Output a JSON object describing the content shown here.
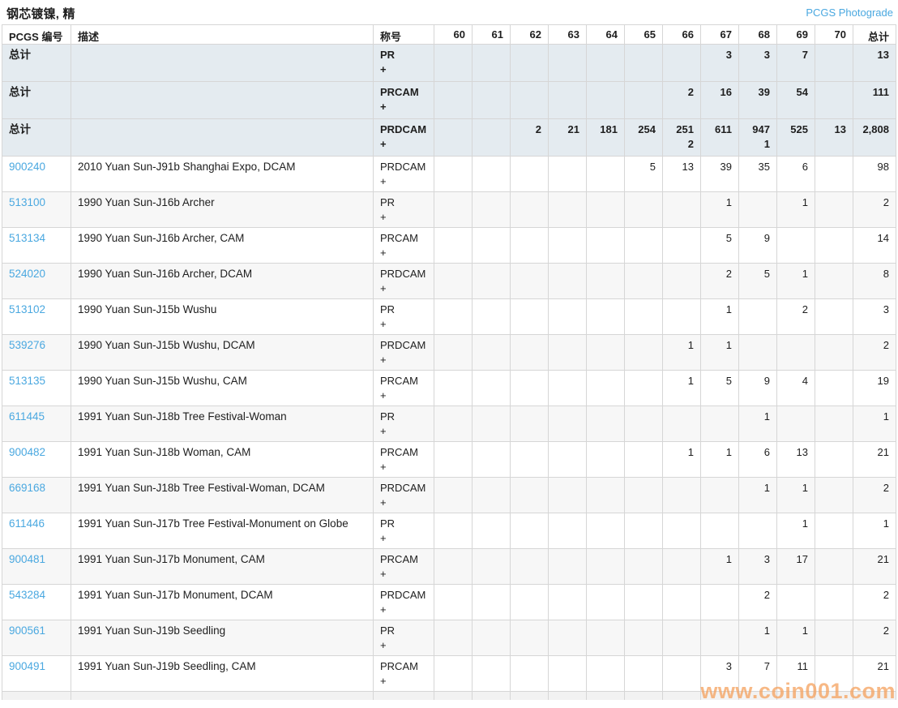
{
  "page": {
    "title": "钢芯镀镍, 精",
    "photograde_link": "PCGS Photograde"
  },
  "colors": {
    "link_blue": "#4aa8e0",
    "summary_row_bg": "#e4ebf0",
    "alt_row_bg": "#f7f7f7",
    "border": "#d6d6d6",
    "watermark_orange": "#f4a05c"
  },
  "watermark": {
    "text": "www.coin001.com"
  },
  "table": {
    "headers": {
      "pcgs_no": "PCGS 编号",
      "description": "描述",
      "designation": "称号",
      "grades": [
        "60",
        "61",
        "62",
        "63",
        "64",
        "65",
        "66",
        "67",
        "68",
        "69",
        "70"
      ],
      "total": "总计"
    },
    "summary_rows": [
      {
        "label": "总计",
        "designation": "PR",
        "plus": "+",
        "grades": {
          "67": "3",
          "68": "3",
          "69": "7"
        },
        "grades_plus": {},
        "total": "13"
      },
      {
        "label": "总计",
        "designation": "PRCAM",
        "plus": "+",
        "grades": {
          "66": "2",
          "67": "16",
          "68": "39",
          "69": "54"
        },
        "grades_plus": {},
        "total": "111"
      },
      {
        "label": "总计",
        "designation": "PRDCAM",
        "plus": "+",
        "grades": {
          "62": "2",
          "63": "21",
          "64": "181",
          "65": "254",
          "66": "251",
          "67": "611",
          "68": "947",
          "69": "525",
          "70": "13"
        },
        "grades_plus": {
          "66": "2",
          "68": "1"
        },
        "total": "2,808"
      }
    ],
    "rows": [
      {
        "pcgs_no": "900240",
        "description": "2010 Yuan Sun-J91b Shanghai Expo, DCAM",
        "designation": "PRDCAM",
        "plus": "+",
        "grades": {
          "65": "5",
          "66": "13",
          "67": "39",
          "68": "35",
          "69": "6"
        },
        "grades_plus": {},
        "total": "98"
      },
      {
        "pcgs_no": "513100",
        "description": "1990 Yuan Sun-J16b Archer",
        "designation": "PR",
        "plus": "+",
        "grades": {
          "67": "1",
          "69": "1"
        },
        "grades_plus": {},
        "total": "2"
      },
      {
        "pcgs_no": "513134",
        "description": "1990 Yuan Sun-J16b Archer, CAM",
        "designation": "PRCAM",
        "plus": "+",
        "grades": {
          "67": "5",
          "68": "9"
        },
        "grades_plus": {},
        "total": "14"
      },
      {
        "pcgs_no": "524020",
        "description": "1990 Yuan Sun-J16b Archer, DCAM",
        "designation": "PRDCAM",
        "plus": "+",
        "grades": {
          "67": "2",
          "68": "5",
          "69": "1"
        },
        "grades_plus": {},
        "total": "8"
      },
      {
        "pcgs_no": "513102",
        "description": "1990 Yuan Sun-J15b Wushu",
        "designation": "PR",
        "plus": "+",
        "grades": {
          "67": "1",
          "69": "2"
        },
        "grades_plus": {},
        "total": "3"
      },
      {
        "pcgs_no": "539276",
        "description": "1990 Yuan Sun-J15b Wushu, DCAM",
        "designation": "PRDCAM",
        "plus": "+",
        "grades": {
          "66": "1",
          "67": "1"
        },
        "grades_plus": {},
        "total": "2"
      },
      {
        "pcgs_no": "513135",
        "description": "1990 Yuan Sun-J15b Wushu, CAM",
        "designation": "PRCAM",
        "plus": "+",
        "grades": {
          "66": "1",
          "67": "5",
          "68": "9",
          "69": "4"
        },
        "grades_plus": {},
        "total": "19"
      },
      {
        "pcgs_no": "611445",
        "description": "1991 Yuan Sun-J18b Tree Festival-Woman",
        "designation": "PR",
        "plus": "+",
        "grades": {
          "68": "1"
        },
        "grades_plus": {},
        "total": "1"
      },
      {
        "pcgs_no": "900482",
        "description": "1991 Yuan Sun-J18b Woman, CAM",
        "designation": "PRCAM",
        "plus": "+",
        "grades": {
          "66": "1",
          "67": "1",
          "68": "6",
          "69": "13"
        },
        "grades_plus": {},
        "total": "21"
      },
      {
        "pcgs_no": "669168",
        "description": "1991 Yuan Sun-J18b Tree Festival-Woman, DCAM",
        "designation": "PRDCAM",
        "plus": "+",
        "grades": {
          "68": "1",
          "69": "1"
        },
        "grades_plus": {},
        "total": "2"
      },
      {
        "pcgs_no": "611446",
        "description": "1991 Yuan Sun-J17b Tree Festival-Monument on Globe",
        "designation": "PR",
        "plus": "+",
        "grades": {
          "69": "1"
        },
        "grades_plus": {},
        "total": "1"
      },
      {
        "pcgs_no": "900481",
        "description": "1991 Yuan Sun-J17b Monument, CAM",
        "designation": "PRCAM",
        "plus": "+",
        "grades": {
          "67": "1",
          "68": "3",
          "69": "17"
        },
        "grades_plus": {},
        "total": "21"
      },
      {
        "pcgs_no": "543284",
        "description": "1991 Yuan Sun-J17b Monument, DCAM",
        "designation": "PRDCAM",
        "plus": "+",
        "grades": {
          "68": "2"
        },
        "grades_plus": {},
        "total": "2"
      },
      {
        "pcgs_no": "900561",
        "description": "1991 Yuan Sun-J19b Seedling",
        "designation": "PR",
        "plus": "+",
        "grades": {
          "68": "1",
          "69": "1"
        },
        "grades_plus": {},
        "total": "2"
      },
      {
        "pcgs_no": "900491",
        "description": "1991 Yuan Sun-J19b Seedling, CAM",
        "designation": "PRCAM",
        "plus": "+",
        "grades": {
          "67": "3",
          "68": "7",
          "69": "11"
        },
        "grades_plus": {},
        "total": "21"
      }
    ]
  }
}
